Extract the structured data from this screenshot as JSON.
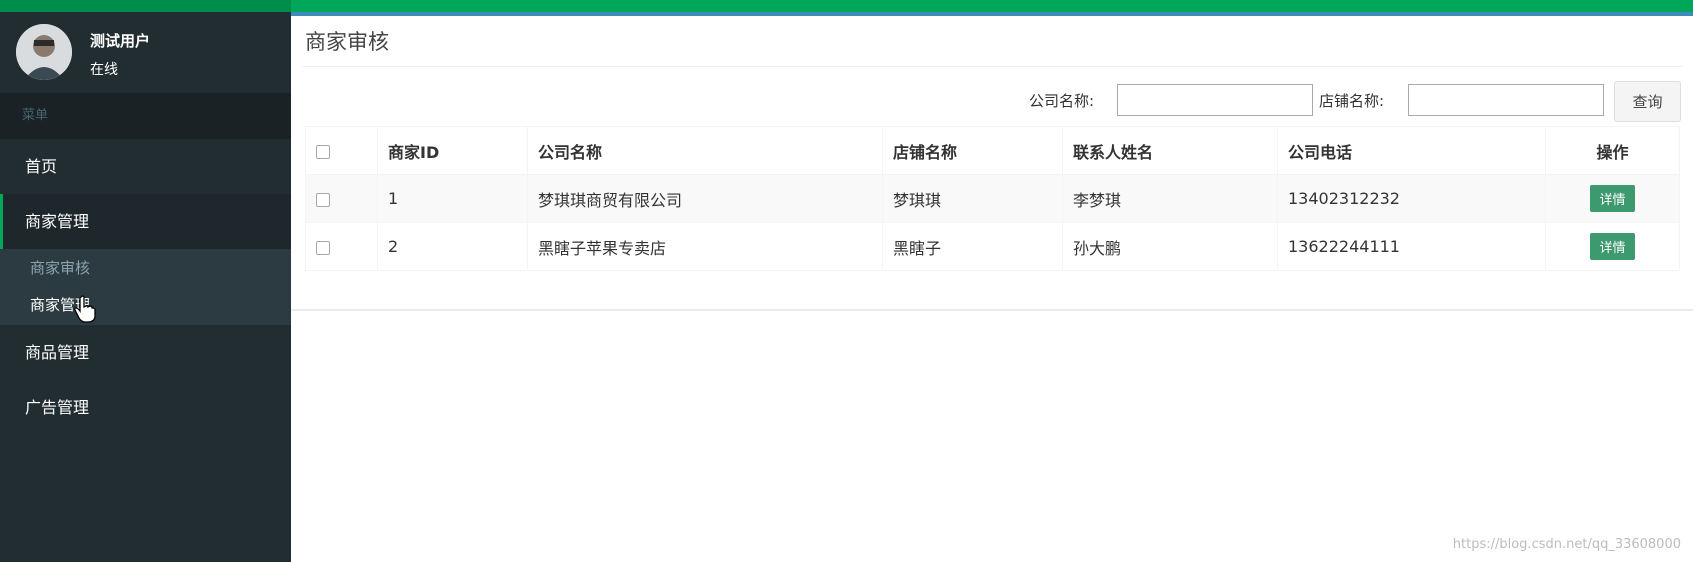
{
  "user": {
    "name": "测试用户",
    "status": "在线"
  },
  "sidebar": {
    "menu_header": "菜单",
    "items": [
      {
        "label": "首页"
      },
      {
        "label": "商家管理"
      },
      {
        "label": "商品管理"
      },
      {
        "label": "广告管理"
      }
    ],
    "subitems": [
      {
        "label": "商家审核"
      },
      {
        "label": "商家管理"
      }
    ]
  },
  "main": {
    "title": "商家审核",
    "filters": {
      "company_label": "公司名称:",
      "company_value": "",
      "shop_label": "店铺名称:",
      "shop_value": "",
      "query_label": "查询"
    },
    "table": {
      "headers": [
        "商家ID",
        "公司名称",
        "店铺名称",
        "联系人姓名",
        "公司电话",
        "操作"
      ],
      "rows": [
        {
          "id": "1",
          "company": "梦琪琪商贸有限公司",
          "shop": "梦琪琪",
          "contact": "李梦琪",
          "phone": "13402312232",
          "action": "详情"
        },
        {
          "id": "2",
          "company": "黑瞎子苹果专卖店",
          "shop": "黑瞎子",
          "contact": "孙大鹏",
          "phone": "13622244111",
          "action": "详情"
        }
      ]
    }
  },
  "watermark": "https://blog.csdn.net/qq_33608000",
  "colors": {
    "sidebar_bg": "#222d32",
    "accent_green": "#00a65a",
    "accent_blue": "#3c8dbc",
    "detail_button": "#3c9a6e"
  }
}
